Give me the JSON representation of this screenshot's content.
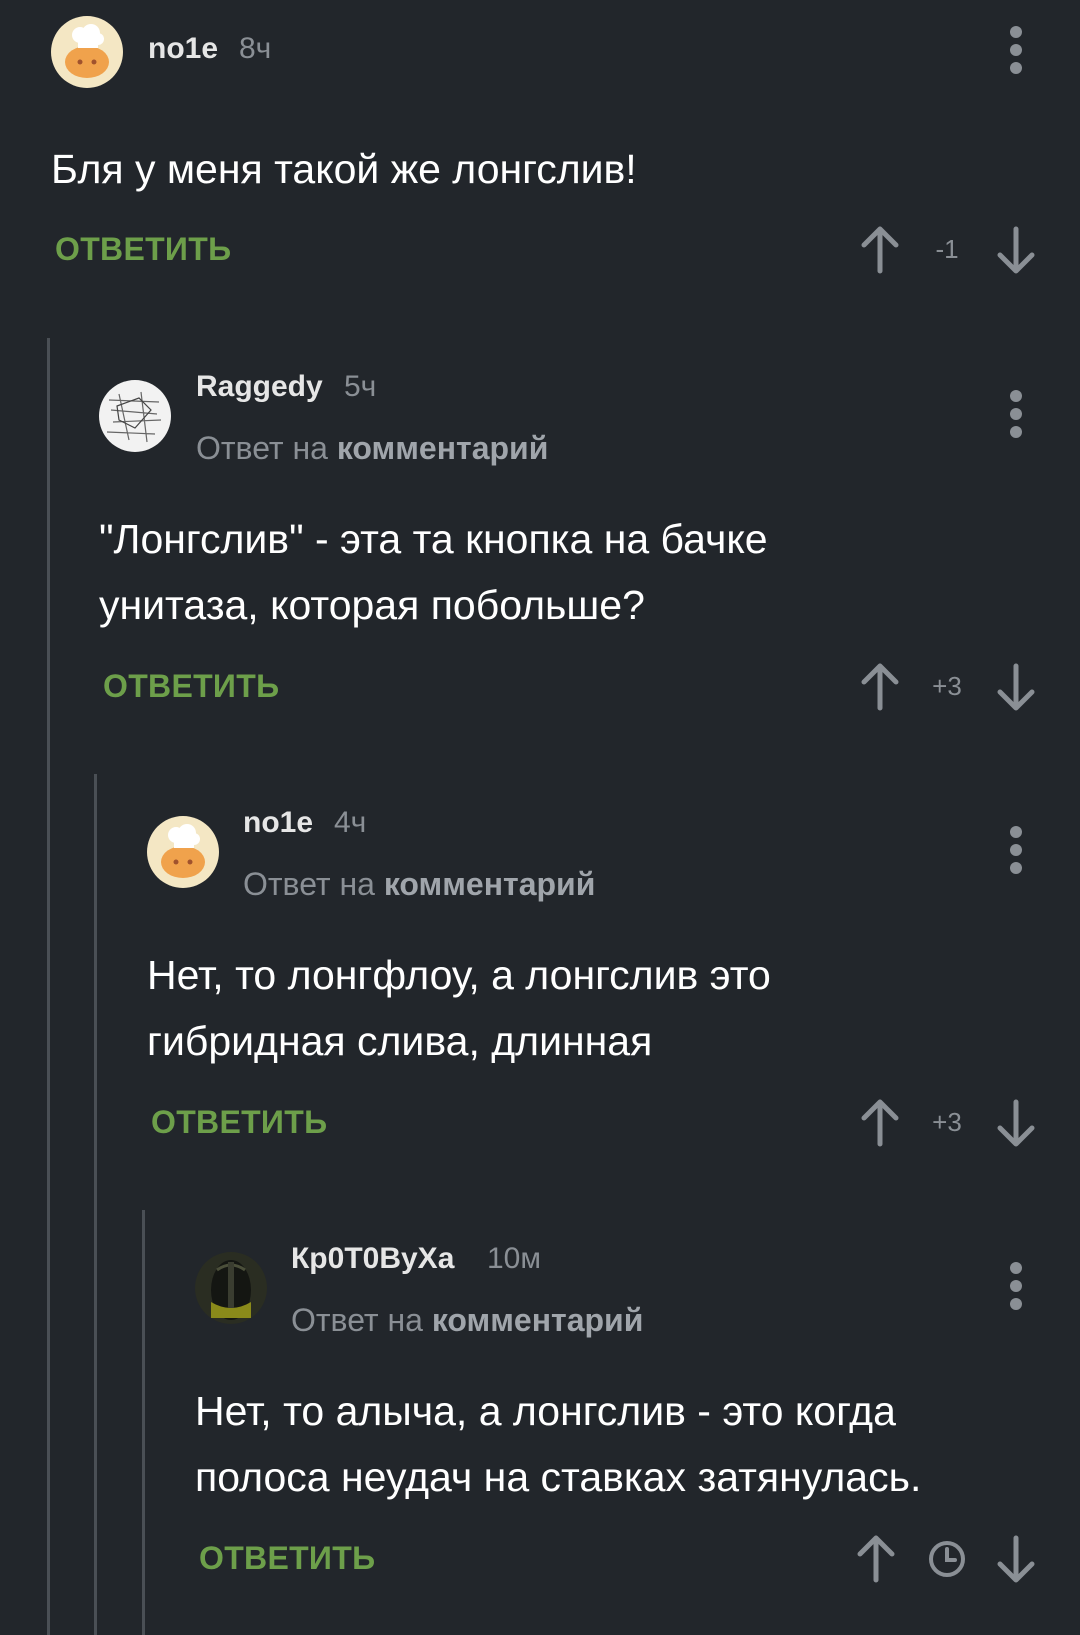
{
  "comments": [
    {
      "username": "no1e",
      "time": "8ч",
      "text": "Бля у меня такой же лонгслив!",
      "reply_label": "ОТВЕТИТЬ",
      "score": "-1"
    },
    {
      "username": "Raggedy",
      "time": "5ч",
      "reply_prefix": "Ответ на",
      "reply_target": "комментарий",
      "text_line1": "\"Лонгслив\" - эта та кнопка на бачке",
      "text_line2": "унитаза, которая побольше?",
      "reply_label": "ОТВЕТИТЬ",
      "score": "+3"
    },
    {
      "username": "no1e",
      "time": "4ч",
      "reply_prefix": "Ответ на",
      "reply_target": "комментарий",
      "text_line1": "Нет, то лонгфлоу, а лонгслив это",
      "text_line2": "гибридная слива, длинная",
      "reply_label": "ОТВЕТИТЬ",
      "score": "+3"
    },
    {
      "username": "Кр0Т0ВуХа",
      "time": "10м",
      "reply_prefix": "Ответ на",
      "reply_target": "комментарий",
      "text_line1": "Нет, то алыча, а лонгслив - это когда",
      "text_line2": "полоса неудач на ставках затянулась.",
      "reply_label": "ОТВЕТИТЬ",
      "score_icon": "clock-icon"
    }
  ],
  "colors": {
    "background": "#22262b",
    "reply_green": "#6d9f4a",
    "muted": "#8a8f95",
    "thread_line": "#4a4f55"
  }
}
